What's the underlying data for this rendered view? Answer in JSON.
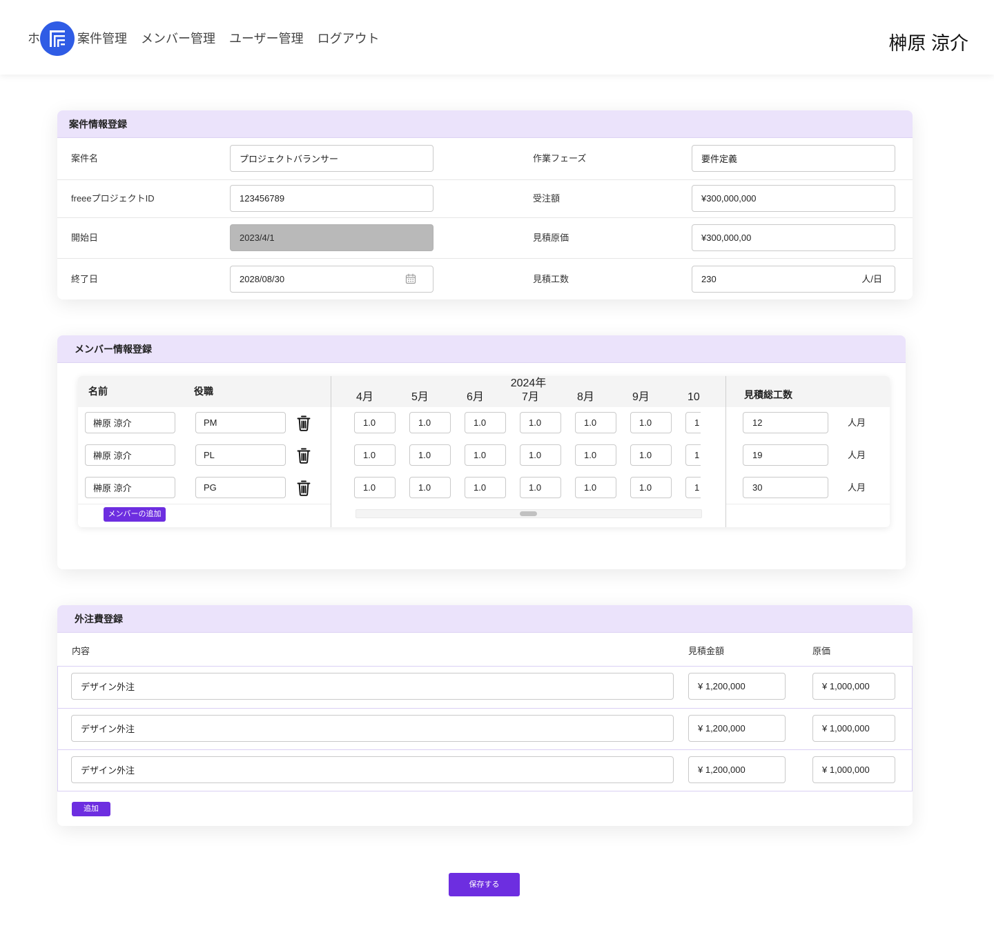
{
  "header": {
    "home_label": "ホ",
    "nav": {
      "projects": "案件管理",
      "members": "メンバー管理",
      "users": "ユーザー管理",
      "logout": "ログアウト"
    },
    "user_name": "榊原 涼介"
  },
  "project_info": {
    "title": "案件情報登録",
    "project_name": {
      "label": "案件名",
      "value": "プロジェクトバランサー"
    },
    "phase": {
      "label": "作業フェーズ",
      "value": "要件定義"
    },
    "freee_project_id": {
      "label": "freeeプロジェクトID",
      "value": "123456789"
    },
    "order_amount": {
      "label": "受注額",
      "value": "¥300,000,000"
    },
    "start_date": {
      "label": "開始日",
      "value": "2023/4/1",
      "disabled": true
    },
    "estimated_cost": {
      "label": "見積原価",
      "value": "¥300,000,00"
    },
    "end_date": {
      "label": "終了日",
      "value": "2028/08/30"
    },
    "estimated_effort": {
      "label": "見積工数",
      "value": "230",
      "unit": "人/日"
    }
  },
  "member_info": {
    "title": "メンバー情報登録",
    "columns": {
      "name": "名前",
      "role": "役職",
      "year": "2024年",
      "total": "見積総工数"
    },
    "months": [
      "4月",
      "5月",
      "6月",
      "7月",
      "8月",
      "9月",
      "10"
    ],
    "rows": [
      {
        "name": "榊原 涼介",
        "role": "PM",
        "months": [
          "1.0",
          "1.0",
          "1.0",
          "1.0",
          "1.0",
          "1.0",
          "1"
        ],
        "total": "12",
        "unit": "人月"
      },
      {
        "name": "榊原 涼介",
        "role": "PL",
        "months": [
          "1.0",
          "1.0",
          "1.0",
          "1.0",
          "1.0",
          "1.0",
          "1"
        ],
        "total": "19",
        "unit": "人月"
      },
      {
        "name": "榊原 涼介",
        "role": "PG",
        "months": [
          "1.0",
          "1.0",
          "1.0",
          "1.0",
          "1.0",
          "1.0",
          "1"
        ],
        "total": "30",
        "unit": "人月"
      }
    ],
    "add_member_label": "メンバーの追加"
  },
  "outsourcing": {
    "title": "外注費登録",
    "columns": {
      "content": "内容",
      "estimate": "見積金額",
      "cost": "原価"
    },
    "rows": [
      {
        "content": "デザイン外注",
        "estimate": "¥ 1,200,000",
        "cost": "¥ 1,000,000"
      },
      {
        "content": "デザイン外注",
        "estimate": "¥ 1,200,000",
        "cost": "¥ 1,000,000"
      },
      {
        "content": "デザイン外注",
        "estimate": "¥ 1,200,000",
        "cost": "¥ 1,000,000"
      }
    ],
    "add_label": "追加"
  },
  "save_label": "保存する",
  "icons": {
    "logo": "freee-logo-icon",
    "calendar": "calendar-icon",
    "delete": "trash-icon"
  },
  "colors": {
    "accent": "#6d2ee0",
    "section_header": "#ebe3fb",
    "logo_blue": "#2f5ce5",
    "disabled_input": "#b9b9b9"
  }
}
